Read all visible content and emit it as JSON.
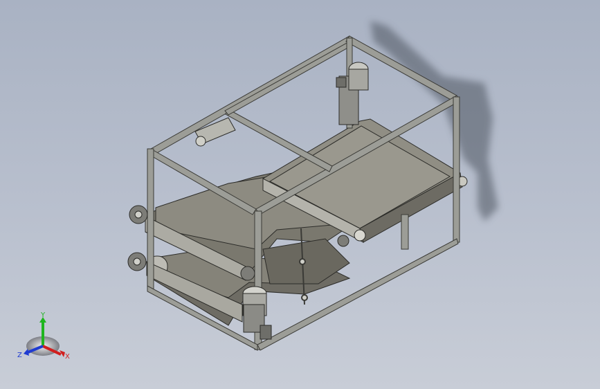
{
  "view": {
    "model_name": "",
    "background_top": "#a9b2c3",
    "background_bottom": "#c8cdd7"
  },
  "triad": {
    "y_label": "Y",
    "x_label": "X",
    "z_label": "Z",
    "x_color": "#d11f1f",
    "y_color": "#1fb51f",
    "z_color": "#1f3bd1"
  },
  "model": {
    "frame_color": "#8c8d87",
    "belt_color": "#7c7b72",
    "shadow_color": "#5e6470",
    "parts": [
      "frame",
      "upper-conveyor",
      "middle-conveyor",
      "lower-conveyor",
      "motor-top",
      "motor-bottom",
      "pneumatic-cylinder",
      "sprockets",
      "shadow"
    ]
  }
}
